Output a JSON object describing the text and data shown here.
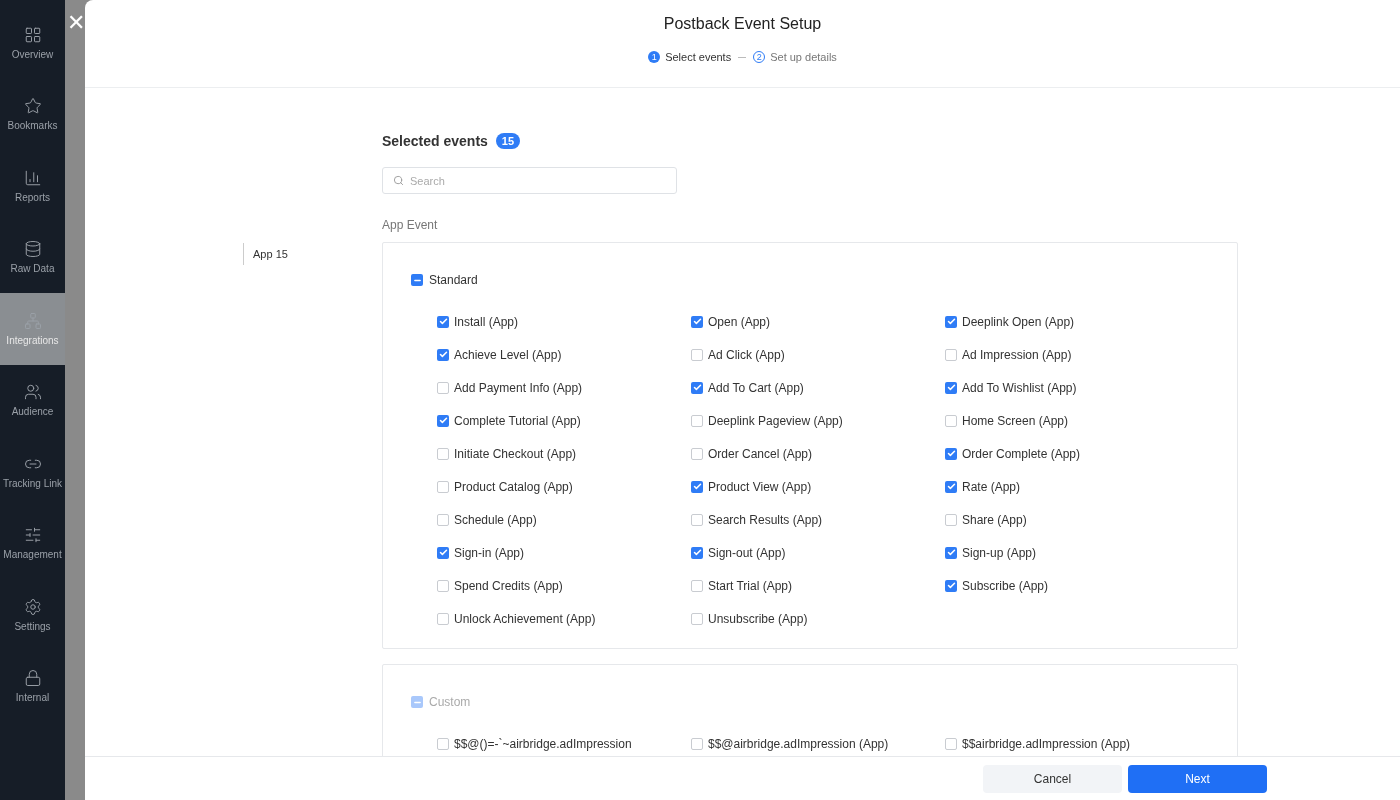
{
  "sidebar": {
    "items": [
      {
        "label": "Overview",
        "selected": false
      },
      {
        "label": "Bookmarks",
        "selected": false
      },
      {
        "label": "Reports",
        "selected": false
      },
      {
        "label": "Raw Data",
        "selected": false
      },
      {
        "label": "Integrations",
        "selected": true
      },
      {
        "label": "Audience",
        "selected": false
      },
      {
        "label": "Tracking Link",
        "selected": false
      },
      {
        "label": "Management",
        "selected": false
      },
      {
        "label": "Settings",
        "selected": false
      },
      {
        "label": "Internal",
        "selected": false
      }
    ]
  },
  "close_button": "✕",
  "modal": {
    "title": "Postback Event Setup",
    "steps": [
      {
        "number": "1",
        "label": "Select events",
        "selected": true
      },
      {
        "number": "2",
        "label": "Set up details",
        "selected": false
      }
    ],
    "side_nav": [
      {
        "label": "App 15",
        "selected": true
      }
    ],
    "selected_heading": "Selected events",
    "selected_count": "15",
    "search": {
      "placeholder": "Search"
    },
    "section_label": "App Event",
    "groups": [
      {
        "label": "Standard",
        "checked": true,
        "indeterminate": true,
        "disabled": false,
        "events": [
          {
            "label": "Install (App)",
            "checked": true
          },
          {
            "label": "Open (App)",
            "checked": true
          },
          {
            "label": "Deeplink Open (App)",
            "checked": true
          },
          {
            "label": "Achieve Level (App)",
            "checked": true
          },
          {
            "label": "Ad Click (App)",
            "checked": false
          },
          {
            "label": "Ad Impression (App)",
            "checked": false
          },
          {
            "label": "Add Payment Info (App)",
            "checked": false
          },
          {
            "label": "Add To Cart (App)",
            "checked": true
          },
          {
            "label": "Add To Wishlist (App)",
            "checked": true
          },
          {
            "label": "Complete Tutorial (App)",
            "checked": true
          },
          {
            "label": "Deeplink Pageview (App)",
            "checked": false
          },
          {
            "label": "Home Screen (App)",
            "checked": false
          },
          {
            "label": "Initiate Checkout (App)",
            "checked": false
          },
          {
            "label": "Order Cancel (App)",
            "checked": false
          },
          {
            "label": "Order Complete (App)",
            "checked": true
          },
          {
            "label": "Product Catalog (App)",
            "checked": false
          },
          {
            "label": "Product View (App)",
            "checked": true
          },
          {
            "label": "Rate (App)",
            "checked": true
          },
          {
            "label": "Schedule (App)",
            "checked": false
          },
          {
            "label": "Search Results (App)",
            "checked": false
          },
          {
            "label": "Share (App)",
            "checked": false
          },
          {
            "label": "Sign-in (App)",
            "checked": true
          },
          {
            "label": "Sign-out (App)",
            "checked": true
          },
          {
            "label": "Sign-up (App)",
            "checked": true
          },
          {
            "label": "Spend Credits (App)",
            "checked": false
          },
          {
            "label": "Start Trial (App)",
            "checked": false
          },
          {
            "label": "Subscribe (App)",
            "checked": true
          },
          {
            "label": "Unlock Achievement (App)",
            "checked": false
          },
          {
            "label": "Unsubscribe (App)",
            "checked": false
          }
        ]
      },
      {
        "label": "Custom",
        "checked": true,
        "indeterminate": true,
        "disabled": true,
        "events": [
          {
            "label": "$$@()=-`~airbridge.adImpression",
            "checked": false
          },
          {
            "label": "$$@airbridge.adImpression (App)",
            "checked": false
          },
          {
            "label": "$$airbridge.adImpression (App)",
            "checked": false
          }
        ]
      }
    ],
    "buttons": [
      {
        "label": "Cancel",
        "kind": "secondary"
      },
      {
        "label": "Next",
        "kind": "primary"
      }
    ]
  }
}
